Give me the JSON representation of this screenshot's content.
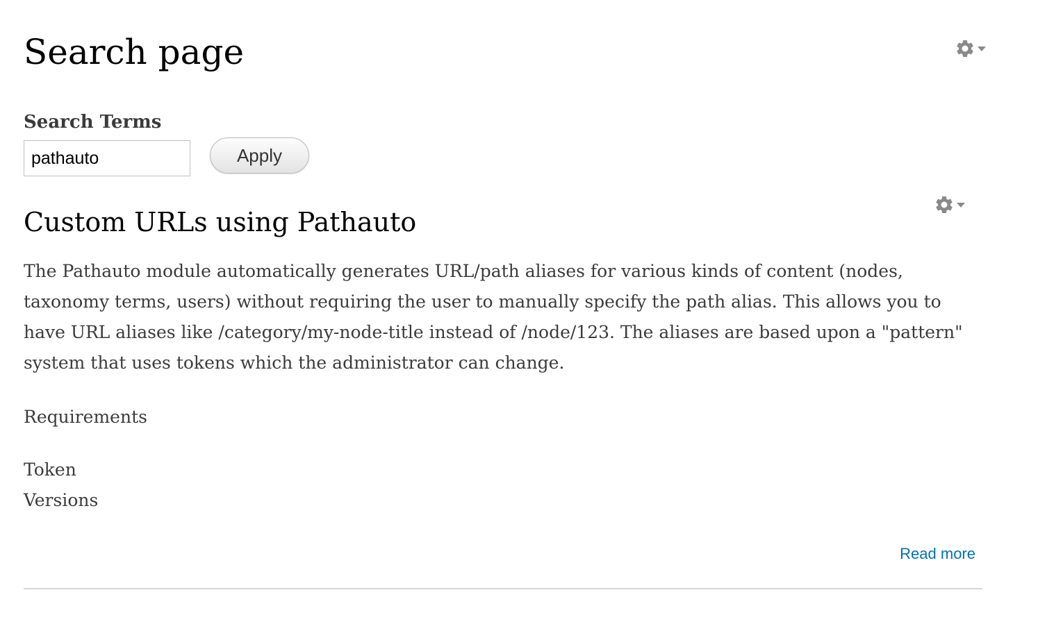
{
  "page": {
    "title": "Search page"
  },
  "search_form": {
    "label": "Search Terms",
    "input_value": "pathauto",
    "apply_label": "Apply"
  },
  "result": {
    "title": "Custom URLs using Pathauto",
    "body": "The Pathauto module automatically generates URL/path aliases for various kinds of content (nodes, taxonomy terms, users) without requiring the user to manually specify the path alias. This allows you to have URL aliases like /category/my-node-title instead of /node/123. The aliases are based upon a \"pattern\" system that uses tokens which the administrator can change.",
    "requirements_heading": "Requirements",
    "requirements_items": [
      "Token",
      "Versions"
    ],
    "read_more_label": "Read more"
  },
  "icons": {
    "page_contextual": "gear-icon",
    "result_contextual": "gear-icon",
    "dropdown": "caret-down-icon"
  },
  "colors": {
    "link": "#0071b3",
    "gear": "#8a8a8a",
    "text": "#3b3b3b",
    "divider": "#d6d6d6"
  }
}
